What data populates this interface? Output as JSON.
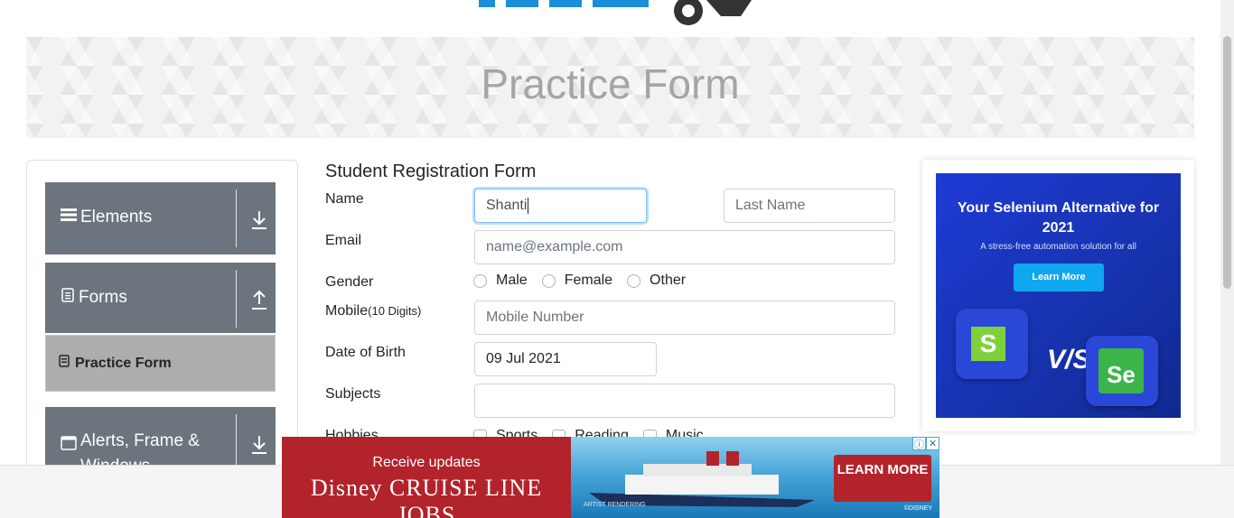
{
  "banner": {
    "title": "Practice Form"
  },
  "sidebar": {
    "groups": [
      {
        "label": "Elements",
        "icon": "hamburger-icon",
        "arrow": "download-arrow-icon"
      },
      {
        "label": "Forms",
        "icon": "document-icon",
        "arrow": "upload-arrow-icon"
      },
      {
        "label": "Alerts, Frame & Windows",
        "icon": "window-icon",
        "arrow": "download-arrow-icon"
      }
    ],
    "active_item": {
      "label": "Practice Form"
    }
  },
  "form": {
    "title": "Student Registration Form",
    "name_label": "Name",
    "first_name_value": "Shanti",
    "last_name_placeholder": "Last Name",
    "email_label": "Email",
    "email_placeholder": "name@example.com",
    "gender_label": "Gender",
    "gender_options": [
      "Male",
      "Female",
      "Other"
    ],
    "mobile_label": "Mobile",
    "mobile_hint": "(10 Digits)",
    "mobile_placeholder": "Mobile Number",
    "dob_label": "Date of Birth",
    "dob_value": "09 Jul 2021",
    "subjects_label": "Subjects",
    "hobbies_label": "Hobbies",
    "hobbies_options": [
      "Sports",
      "Reading",
      "Music"
    ]
  },
  "right_ad": {
    "headline": "Your Selenium Alternative for 2021",
    "subline": "A stress-free automation solution for all",
    "button": "Learn More",
    "vs": "V/S",
    "left_logo": "S",
    "right_logo": "Se"
  },
  "bottom_ad": {
    "line1": "Receive updates",
    "line2": "Disney CRUISE LINE JOBS",
    "cta": "LEARN MORE",
    "caption": "ARTIST RENDERING",
    "copyright": "©DISNEY"
  }
}
